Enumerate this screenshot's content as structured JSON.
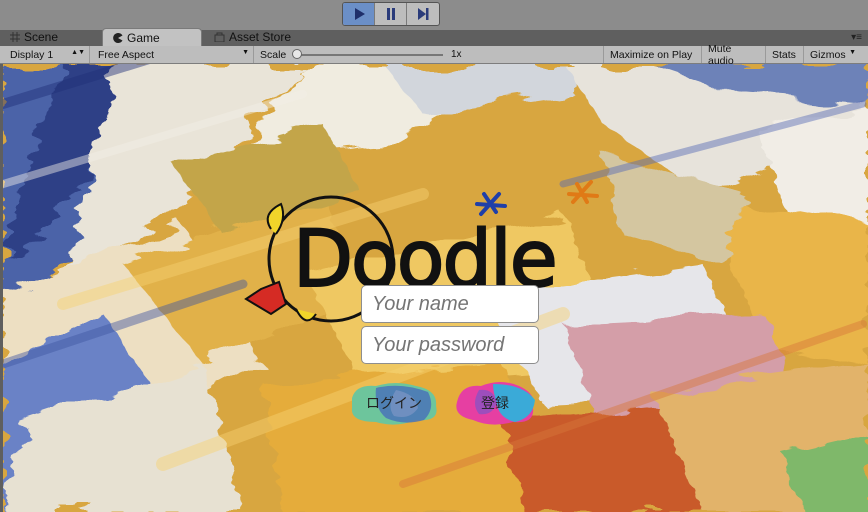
{
  "playbar": {
    "play_icon": "play-icon",
    "pause_icon": "pause-icon",
    "step_icon": "step-icon"
  },
  "tabs": [
    {
      "label": "Scene",
      "icon": "grid-icon"
    },
    {
      "label": "Game",
      "icon": "pacman-icon"
    },
    {
      "label": "Asset Store",
      "icon": "store-icon"
    }
  ],
  "toolbar": {
    "display": "Display 1",
    "aspect": "Free Aspect",
    "scale_label": "Scale",
    "scale_value": "1x",
    "maximize": "Maximize on Play",
    "mute": "Mute audio",
    "stats": "Stats",
    "gizmos": "Gizmos"
  },
  "game": {
    "logo_text": "Doodle",
    "name_placeholder": "Your name",
    "password_placeholder": "Your password",
    "login_label": "ログイン",
    "register_label": "登録"
  },
  "colors": {
    "selected_play": "#6b8fc7",
    "paint_yellow": "#e9b33b",
    "paint_blue": "#3e5aa5"
  }
}
